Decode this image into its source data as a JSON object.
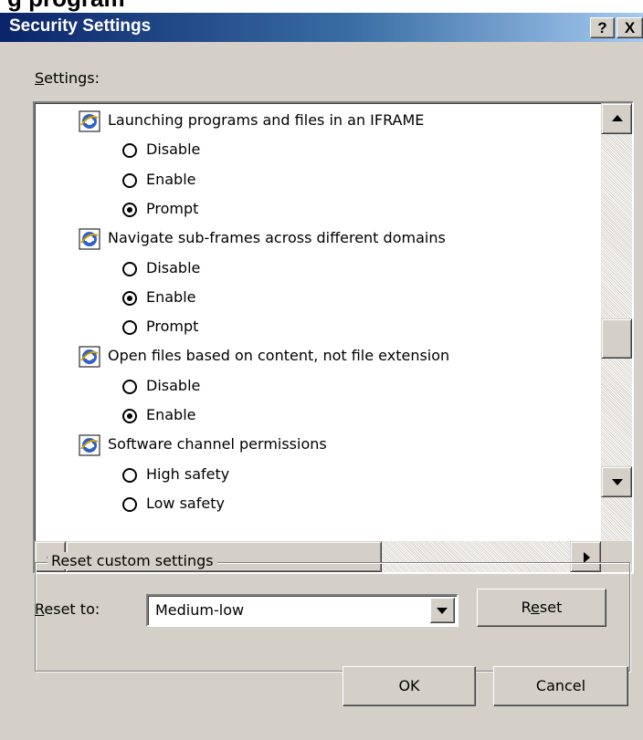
{
  "window": {
    "title": "Security Settings",
    "help_glyph": "?",
    "close_glyph": "X",
    "cropped_heading": "g program"
  },
  "settings": {
    "label_prefix_underlined": "S",
    "label_rest": "ettings:",
    "items": [
      {
        "kind": "heading",
        "text": "Launching programs and files in an IFRAME",
        "icon": "ie-setting-icon"
      },
      {
        "kind": "option",
        "text": "Disable",
        "checked": false
      },
      {
        "kind": "option",
        "text": "Enable",
        "checked": false
      },
      {
        "kind": "option",
        "text": "Prompt",
        "checked": true
      },
      {
        "kind": "heading",
        "text": "Navigate sub-frames across different domains",
        "icon": "ie-setting-icon"
      },
      {
        "kind": "option",
        "text": "Disable",
        "checked": false
      },
      {
        "kind": "option",
        "text": "Enable",
        "checked": true
      },
      {
        "kind": "option",
        "text": "Prompt",
        "checked": false
      },
      {
        "kind": "heading",
        "text": "Open files based on content, not file extension",
        "icon": "ie-setting-icon"
      },
      {
        "kind": "option",
        "text": "Disable",
        "checked": false
      },
      {
        "kind": "option",
        "text": "Enable",
        "checked": true
      },
      {
        "kind": "heading",
        "text": "Software channel permissions",
        "icon": "ie-setting-icon"
      },
      {
        "kind": "option",
        "text": "High safety",
        "checked": false
      },
      {
        "kind": "option",
        "text": "Low safety",
        "checked": false
      }
    ]
  },
  "reset_group": {
    "title": "Reset custom settings",
    "label_prefix_underlined": "R",
    "label_rest": "eset to:",
    "selected_value": "Medium-low",
    "reset_button_pre": "R",
    "reset_button_underlined": "e",
    "reset_button_post": "set"
  },
  "buttons": {
    "ok": "OK",
    "cancel": "Cancel"
  },
  "colors": {
    "dialog_face": "#d4d0c8",
    "title_gradient_start": "#0a246a",
    "title_gradient_end": "#a6caf0"
  }
}
